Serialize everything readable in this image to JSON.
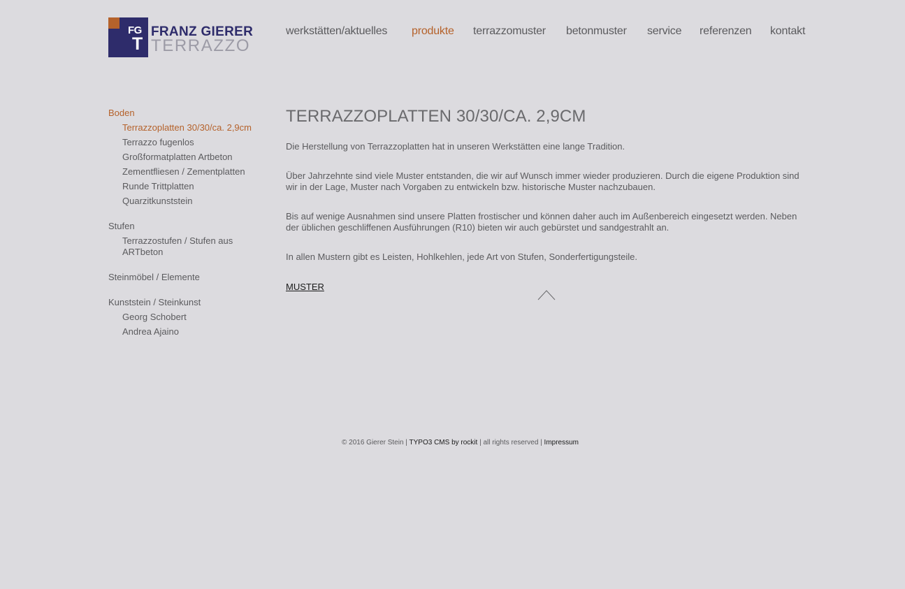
{
  "logo": {
    "initials": "FG",
    "initial2": "T",
    "line1": "FRANZ GIERER",
    "line2": "TERRAZZO",
    "colors": {
      "navy": "#2e2c6b",
      "orange": "#b5622b"
    }
  },
  "nav": [
    {
      "label": "werkstätten/aktuelles",
      "active": false
    },
    {
      "label": "produkte",
      "active": true
    },
    {
      "label": "terrazzomuster",
      "active": false
    },
    {
      "label": "betonmuster",
      "active": false
    },
    {
      "label": "service",
      "active": false
    },
    {
      "label": "referenzen",
      "active": false
    },
    {
      "label": "kontakt",
      "active": false
    }
  ],
  "sidebar": [
    {
      "label": "Boden",
      "items": [
        "Terrazzoplatten 30/30/ca. 2,9cm",
        "Terrazzo fugenlos",
        "Großformatplatten Artbeton",
        "Zementfliesen / Zementplatten",
        "Runde Trittplatten",
        "Quarzitkunststein"
      ]
    },
    {
      "label": "Stufen",
      "items": [
        "Terrazzostufen / Stufen aus ARTbeton"
      ]
    },
    {
      "label": "Steinmöbel / Elemente",
      "items": []
    },
    {
      "label": "Kunststein / Steinkunst",
      "items": [
        "Georg Schobert",
        "Andrea Ajaino"
      ]
    }
  ],
  "content": {
    "title": "TERRAZZOPLATTEN 30/30/CA. 2,9CM",
    "paragraphs": [
      "Die Herstellung von Terrazzoplatten hat in unseren Werkstätten eine lange Tradition.",
      "Über Jahrzehnte sind viele Muster entstanden, die wir auf Wunsch immer wieder produzieren. Durch die eigene Produktion sind wir in der Lage, Muster nach Vorgaben zu entwickeln bzw. historische Muster nachzubauen.",
      "Bis auf wenige Ausnahmen sind unsere Platten frostischer und können daher auch im Außenbereich eingesetzt werden. Neben der üblichen geschliffenen Ausführungen (R10) bieten wir auch gebürstet und sandgestrahlt an.",
      "In allen Mustern gibt es Leisten, Hohlkehlen, jede Art von Stufen, Sonderfertigungsteile."
    ],
    "link": "MUSTER"
  },
  "footer": {
    "copyright": "© 2016 Gierer Stein | ",
    "cms": "TYPO3 CMS by rockit",
    "rights": " | all rights reserved | ",
    "impressum": "Impressum"
  },
  "icons": {
    "scroll_top": "chevron-up-icon"
  }
}
